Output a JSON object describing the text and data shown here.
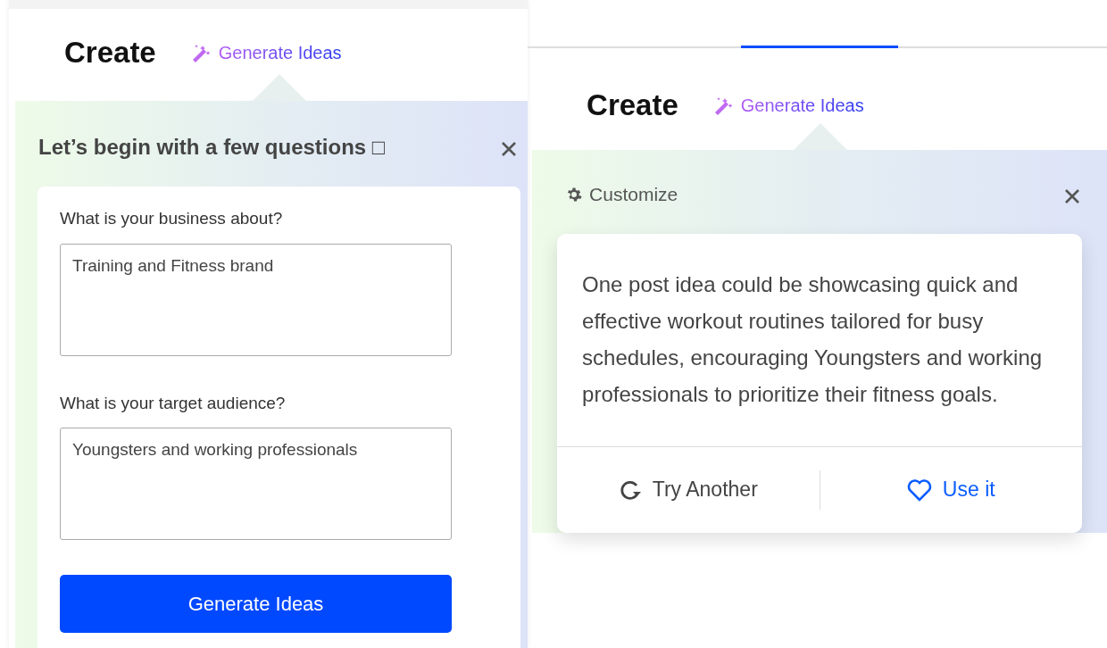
{
  "panels": [
    {
      "kind": "questions",
      "heading": "Create",
      "link": "Generate Ideas",
      "popover": {
        "title": "Let’s begin with a few questions □",
        "fields": [
          {
            "label": "What is your business about?",
            "value": "Training and Fitness brand"
          },
          {
            "label": "What is your target audience?",
            "value": "Youngsters and working professionals"
          }
        ],
        "button": "Generate Ideas"
      }
    },
    {
      "kind": "idea",
      "heading": "Create",
      "link": "Generate Ideas",
      "popover": {
        "title": "Customize",
        "idea": "One post idea could be showcasing quick and effective workout routines tailored for busy schedules, encouraging Youngsters and working professionals to prioritize their fitness goals.",
        "actions": [
          {
            "kind": "retry",
            "label": "Try Another"
          },
          {
            "kind": "use",
            "label": "Use it"
          }
        ]
      }
    }
  ]
}
